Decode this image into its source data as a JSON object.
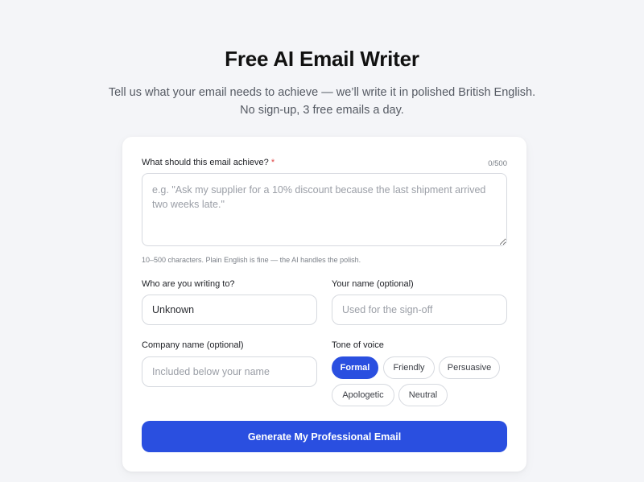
{
  "header": {
    "title": "Free AI Email Writer",
    "subtitle_line1": "Tell us what your email needs to achieve — we’ll write it in polished British English.",
    "subtitle_line2": "No sign-up, 3 free emails a day."
  },
  "form": {
    "goal": {
      "label": "What should this email achieve?",
      "required_mark": "*",
      "counter": "0/500",
      "value": "",
      "placeholder": "e.g. \"Ask my supplier for a 10% discount because the last shipment arrived two weeks late.\"",
      "hint": "10–500 characters. Plain English is fine — the AI handles the polish."
    },
    "recipient": {
      "label": "Who are you writing to?",
      "value": "Unknown"
    },
    "your_name": {
      "label": "Your name (optional)",
      "value": "",
      "placeholder": "Used for the sign-off"
    },
    "company": {
      "label": "Company name (optional)",
      "value": "",
      "placeholder": "Included below your name"
    },
    "tone": {
      "label": "Tone of voice",
      "options": [
        "Formal",
        "Friendly",
        "Persuasive",
        "Apologetic",
        "Neutral"
      ],
      "selected": "Formal"
    },
    "submit_label": "Generate My Professional Email"
  },
  "colors": {
    "accent": "#2a4fe0",
    "background": "#f4f5f8",
    "required": "#e04848"
  }
}
